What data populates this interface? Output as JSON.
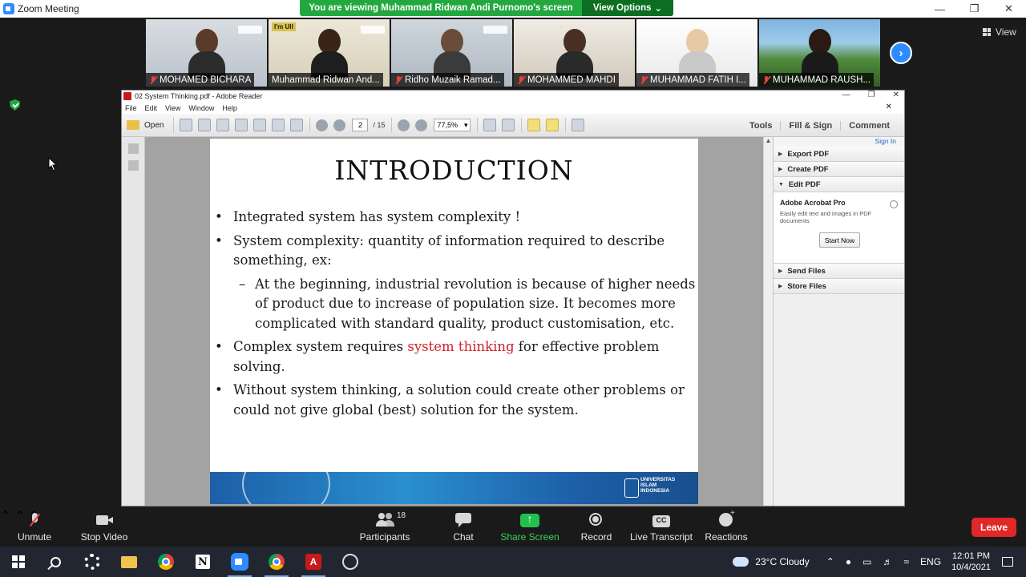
{
  "window": {
    "title": "Zoom Meeting"
  },
  "banner": {
    "text": "You are viewing Muhammad Ridwan Andi Purnomo's screen",
    "view_options": "View Options"
  },
  "participants_strip": [
    {
      "name": "MOHAMED BICHARA",
      "muted": true
    },
    {
      "name": "Muhammad Ridwan And...",
      "muted": false,
      "badge": "I'm UII"
    },
    {
      "name": "Ridho Muzaik Ramad...",
      "muted": true
    },
    {
      "name": "MOHAMMED  MAHDI",
      "muted": true
    },
    {
      "name": "MUHAMMAD FATIH I...",
      "muted": true
    },
    {
      "name": "MUHAMMAD RAUSH...",
      "muted": true
    }
  ],
  "view_button": "View",
  "reader": {
    "title": "02 System Thinking.pdf - Adobe Reader",
    "menu": [
      "File",
      "Edit",
      "View",
      "Window",
      "Help"
    ],
    "open": "Open",
    "page": "2",
    "page_total": "/ 15",
    "zoom": "77,5%",
    "tools": "Tools",
    "fill_sign": "Fill & Sign",
    "comment": "Comment"
  },
  "slide": {
    "title": "INTRODUCTION",
    "b1": "Integrated system has system complexity !",
    "b2": "System complexity: quantity of information required to describe something, ex:",
    "b2_sub": "At the beginning, industrial revolution is because of higher needs of product due to increase of population size. It becomes more complicated with standard quality, product customisation, etc.",
    "b3_pre": "Complex system requires ",
    "b3_red": "system thinking",
    "b3_post": " for effective problem solving.",
    "b4": "Without system thinking, a solution could create other problems or could not give global (best) solution for the system.",
    "footer_logo": "UNIVERSITAS ISLAM INDONESIA"
  },
  "right_pane": {
    "sign_in": "Sign In",
    "export_pdf": "Export PDF",
    "create_pdf": "Create PDF",
    "edit_pdf": "Edit PDF",
    "acrobat_title": "Adobe Acrobat Pro",
    "acrobat_desc": "Easily edit text and images in PDF documents",
    "start_now": "Start Now",
    "send_files": "Send Files",
    "store_files": "Store Files"
  },
  "toolbar": {
    "unmute": "Unmute",
    "stop_video": "Stop Video",
    "participants": "Participants",
    "participant_count": "18",
    "chat": "Chat",
    "share_screen": "Share Screen",
    "record": "Record",
    "live_transcript": "Live Transcript",
    "reactions": "Reactions",
    "leave": "Leave"
  },
  "taskbar": {
    "weather": "23°C  Cloudy",
    "lang": "ENG",
    "time": "12:01 PM",
    "date": "10/4/2021"
  }
}
